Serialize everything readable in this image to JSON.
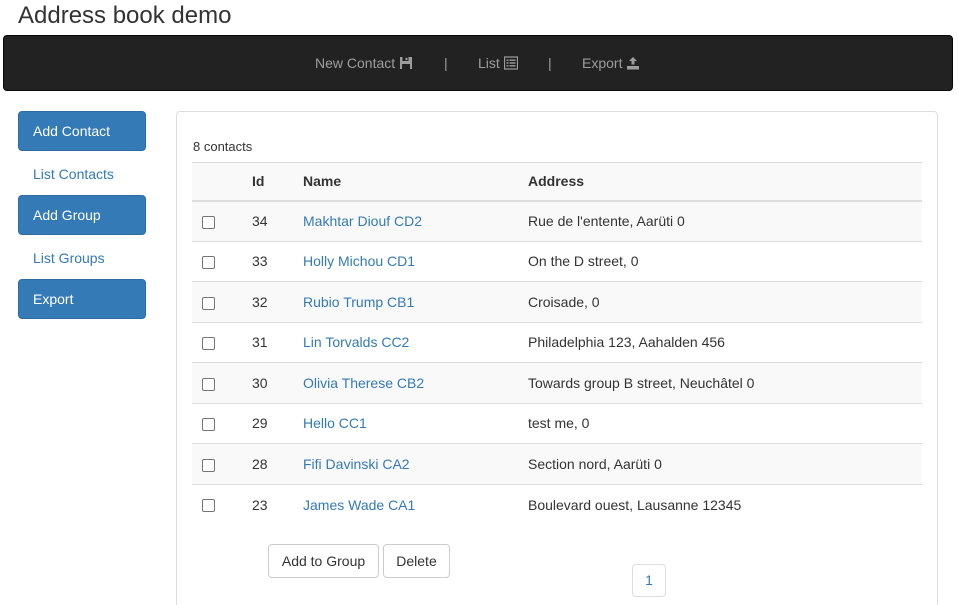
{
  "app": {
    "title": "Address book demo"
  },
  "navbar": {
    "items": [
      {
        "label": "New Contact",
        "icon": "floppy-disk-icon"
      },
      {
        "label": "List",
        "icon": "list-alt-icon"
      },
      {
        "label": "Export",
        "icon": "export-icon"
      }
    ],
    "separator": "|"
  },
  "sidebar": {
    "add_contact": "Add Contact",
    "list_contacts": "List Contacts",
    "add_group": "Add Group",
    "list_groups": "List Groups",
    "export": "Export"
  },
  "main": {
    "count": "8 contacts",
    "columns": [
      "",
      "Id",
      "Name",
      "Address"
    ],
    "rows": [
      {
        "id": "34",
        "name": "Makhtar Diouf CD2",
        "address": "Rue de l'entente, Aarüti 0"
      },
      {
        "id": "33",
        "name": "Holly Michou CD1",
        "address": "On the D street, 0"
      },
      {
        "id": "32",
        "name": "Rubio Trump CB1",
        "address": "Croisade, 0"
      },
      {
        "id": "31",
        "name": "Lin Torvalds CC2",
        "address": "Philadelphia 123, Aahalden 456"
      },
      {
        "id": "30",
        "name": "Olivia Therese CB2",
        "address": "Towards group B street, Neuchâtel 0"
      },
      {
        "id": "29",
        "name": "Hello CC1",
        "address": "test me, 0"
      },
      {
        "id": "28",
        "name": "Fifi Davinski CA2",
        "address": "Section nord, Aarüti 0"
      },
      {
        "id": "23",
        "name": "James Wade CA1",
        "address": "Boulevard ouest, Lausanne 12345"
      }
    ],
    "add_to_group_label": "Add to Group",
    "delete_label": "Delete",
    "page": "1"
  },
  "colors": {
    "primary": "#337ab7",
    "navbar": "#222222",
    "nav_text": "#9d9d9d"
  }
}
